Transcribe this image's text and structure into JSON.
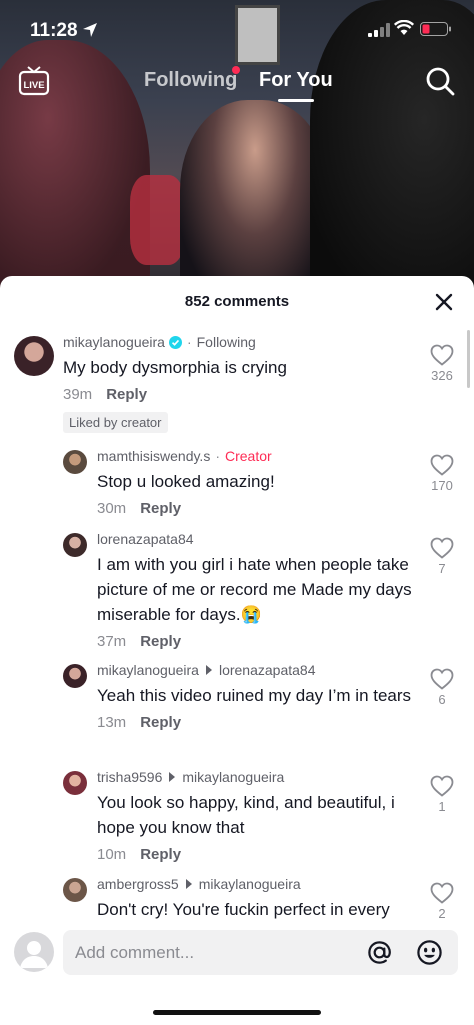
{
  "status_bar": {
    "time": "11:28"
  },
  "top_nav": {
    "live_label": "LIVE",
    "tabs": [
      {
        "label": "Following",
        "active": false
      },
      {
        "label": "For You",
        "active": true
      }
    ]
  },
  "sheet": {
    "title": "852 comments",
    "comments": [
      {
        "user": "mikaylanogueira",
        "verified": true,
        "tag": "Following",
        "text": "My body dysmorphia is crying",
        "time": "39m",
        "reply": "Reply",
        "badge": "Liked by creator",
        "likes": "326"
      },
      {
        "user": "mamthisiswendy.s",
        "tag": "Creator",
        "text": "Stop u looked amazing!",
        "time": "30m",
        "reply": "Reply",
        "likes": "170"
      },
      {
        "user": "lorenazapata84",
        "text": "I am with you girl i hate when people take picture of me or record me Made my days miserable for days.😭",
        "time": "37m",
        "reply": "Reply",
        "likes": "7"
      },
      {
        "user": "mikaylanogueira",
        "reply_to": "lorenazapata84",
        "text": "Yeah this video ruined my day I’m in tears",
        "time": "13m",
        "reply": "Reply",
        "likes": "6"
      },
      {
        "user": "trisha9596",
        "reply_to": "mikaylanogueira",
        "text": "You look so happy, kind, and beautiful, i hope you know that",
        "time": "10m",
        "reply": "Reply",
        "likes": "1"
      },
      {
        "user": "ambergross5",
        "reply_to": "mikaylanogueira",
        "text": "Don't cry! You're fuckin perfect in every",
        "likes": "2"
      }
    ]
  },
  "composer": {
    "placeholder": "Add comment..."
  },
  "colors": {
    "accent": "#fe2c55",
    "text": "#161823",
    "muted": "#8a8b91"
  },
  "icons": [
    "location-arrow-icon",
    "signal-icon",
    "wifi-icon",
    "battery-icon",
    "live-icon",
    "search-icon",
    "close-icon",
    "verified-icon",
    "heart-icon",
    "at-icon",
    "emoji-icon"
  ]
}
